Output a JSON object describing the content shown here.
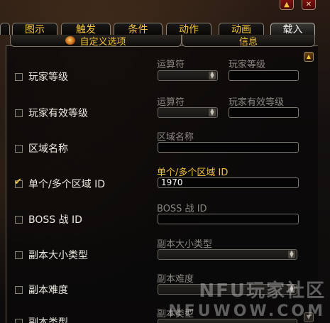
{
  "window": {
    "up_button_icon": "arrow-up-icon",
    "close_button_icon": "close-icon"
  },
  "tabs": [
    {
      "label": "图示"
    },
    {
      "label": "触发"
    },
    {
      "label": "条件"
    },
    {
      "label": "动作"
    },
    {
      "label": "动画"
    },
    {
      "label": "载入",
      "active": true
    }
  ],
  "subtabs": {
    "custom_options": "自定义选项",
    "info": "信息"
  },
  "rows": [
    {
      "label": "玩家等级",
      "checked": false
    },
    {
      "label": "玩家有效等级",
      "checked": false
    },
    {
      "label": "区域名称",
      "checked": false
    },
    {
      "label": "单个/多个区域 ID",
      "checked": true
    },
    {
      "label": "BOSS 战 ID",
      "checked": false
    },
    {
      "label": "副本大小类型",
      "checked": false
    },
    {
      "label": "副本难度",
      "checked": false
    },
    {
      "label": "副本类型",
      "checked": false
    }
  ],
  "fields": {
    "player_level": {
      "operator_label": "运算符",
      "value_label": "玩家等级",
      "value": ""
    },
    "effective_level": {
      "operator_label": "运算符",
      "value_label": "玩家有效等级",
      "value": ""
    },
    "zone_name": {
      "label": "区域名称",
      "value": ""
    },
    "zone_id": {
      "label": "单个/多个区域 ID",
      "value": "1970"
    },
    "boss_id": {
      "label": "BOSS 战 ID",
      "value": ""
    },
    "instance_size": {
      "label": "副本大小类型"
    },
    "instance_difficulty": {
      "label": "副本难度"
    },
    "instance_type": {
      "label": "副本类型"
    }
  },
  "watermark": {
    "line1": "NFU玩家社区",
    "line2": "NFUWOW.COM"
  },
  "colors": {
    "accent_gold": "#f2c33b",
    "text": "#eeeae2",
    "disabled": "#8a8680"
  }
}
